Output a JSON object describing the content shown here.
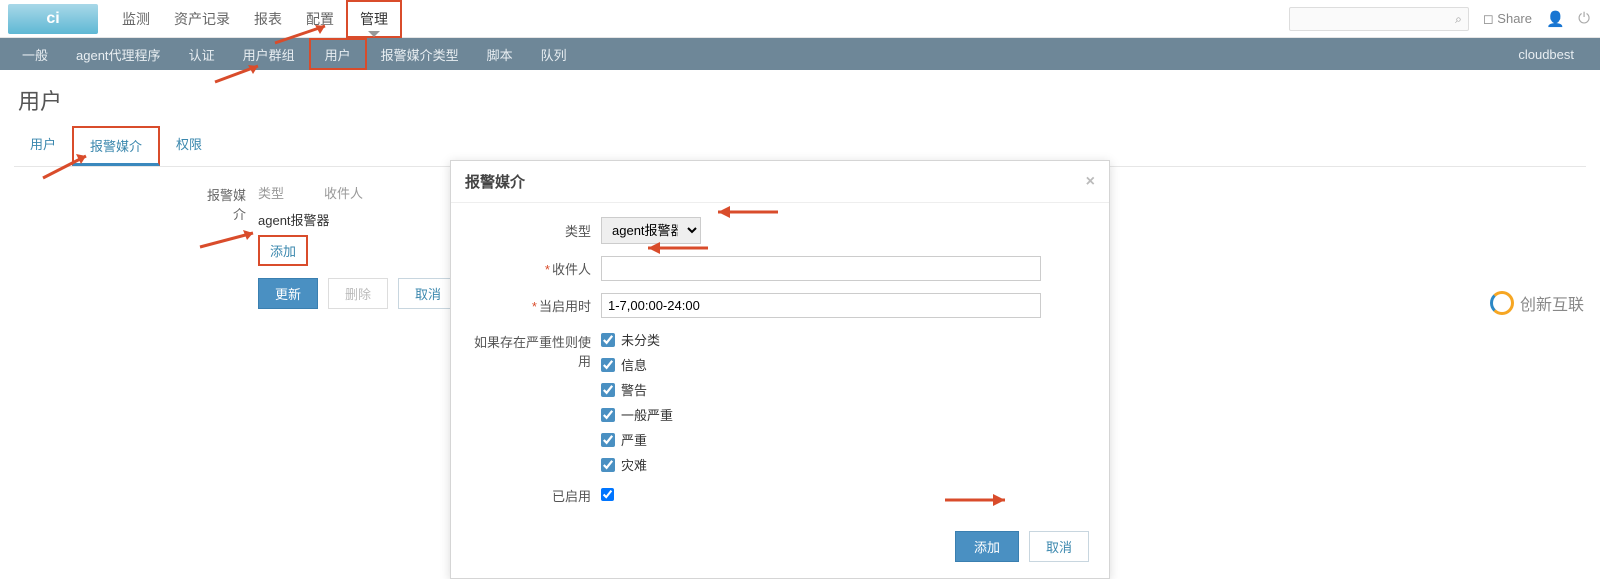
{
  "topnav": {
    "items": [
      "监测",
      "资产记录",
      "报表",
      "配置",
      "管理"
    ],
    "active_index": 4,
    "share_label": "Share",
    "search_placeholder": ""
  },
  "subnav": {
    "items": [
      "一般",
      "agent代理程序",
      "认证",
      "用户群组",
      "用户",
      "报警媒介类型",
      "脚本",
      "队列"
    ],
    "active_index": 4,
    "right_label": "cloudbest"
  },
  "page_title": "用户",
  "tabs": {
    "items": [
      "用户",
      "报警媒介",
      "权限"
    ],
    "active_index": 1
  },
  "media": {
    "section_label": "报警媒介",
    "col_type": "类型",
    "col_recipient": "收件人",
    "row_type_value": "agent报警器",
    "add_link": "添加",
    "btn_update": "更新",
    "btn_delete": "删除",
    "btn_cancel": "取消"
  },
  "dialog": {
    "title": "报警媒介",
    "label_type": "类型",
    "type_value": "agent报警器",
    "label_recipient": "收件人",
    "recipient_value": "",
    "label_when_active": "当启用时",
    "when_active_value": "1-7,00:00-24:00",
    "label_use_if_severity": "如果存在严重性则使用",
    "severities": [
      "未分类",
      "信息",
      "警告",
      "一般严重",
      "严重",
      "灾难"
    ],
    "label_enabled": "已启用",
    "btn_add": "添加",
    "btn_cancel": "取消"
  },
  "brand_text": "创新互联"
}
